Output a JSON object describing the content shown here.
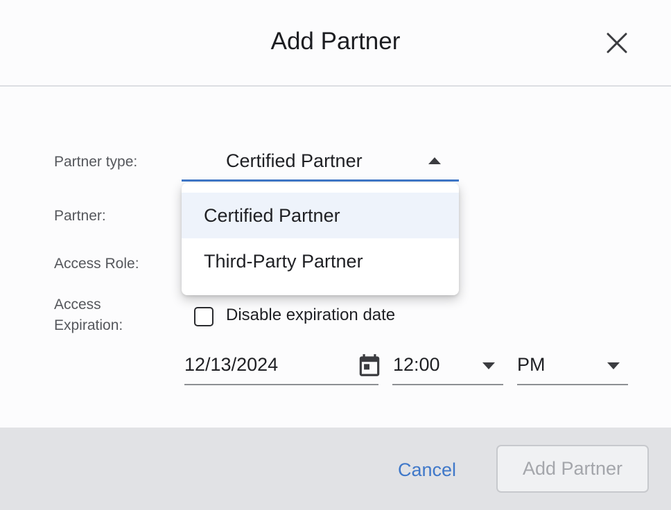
{
  "dialog": {
    "title": "Add Partner"
  },
  "form": {
    "partner_type_label": "Partner type:",
    "partner_type_value": "Certified Partner",
    "partner_label": "Partner:",
    "access_role_label": "Access Role:",
    "access_expiration_label_line1": "Access",
    "access_expiration_label_line2": "Expiration:",
    "disable_expiration_label": "Disable expiration date",
    "disable_expiration_checked": false,
    "date_value": "12/13/2024",
    "time_value": "12:00",
    "ampm_value": "PM"
  },
  "dropdown": {
    "options": [
      {
        "label": "Certified Partner",
        "selected": true
      },
      {
        "label": "Third-Party Partner",
        "selected": false
      }
    ]
  },
  "footer": {
    "cancel_label": "Cancel",
    "submit_label": "Add Partner",
    "submit_disabled": true
  },
  "colors": {
    "accent": "#3f78c9",
    "footer_bg": "#e1e2e5",
    "selected_option_bg": "#eef3fb"
  },
  "icons": [
    "close-icon",
    "caret-up-icon",
    "calendar-icon",
    "caret-down-icon"
  ]
}
